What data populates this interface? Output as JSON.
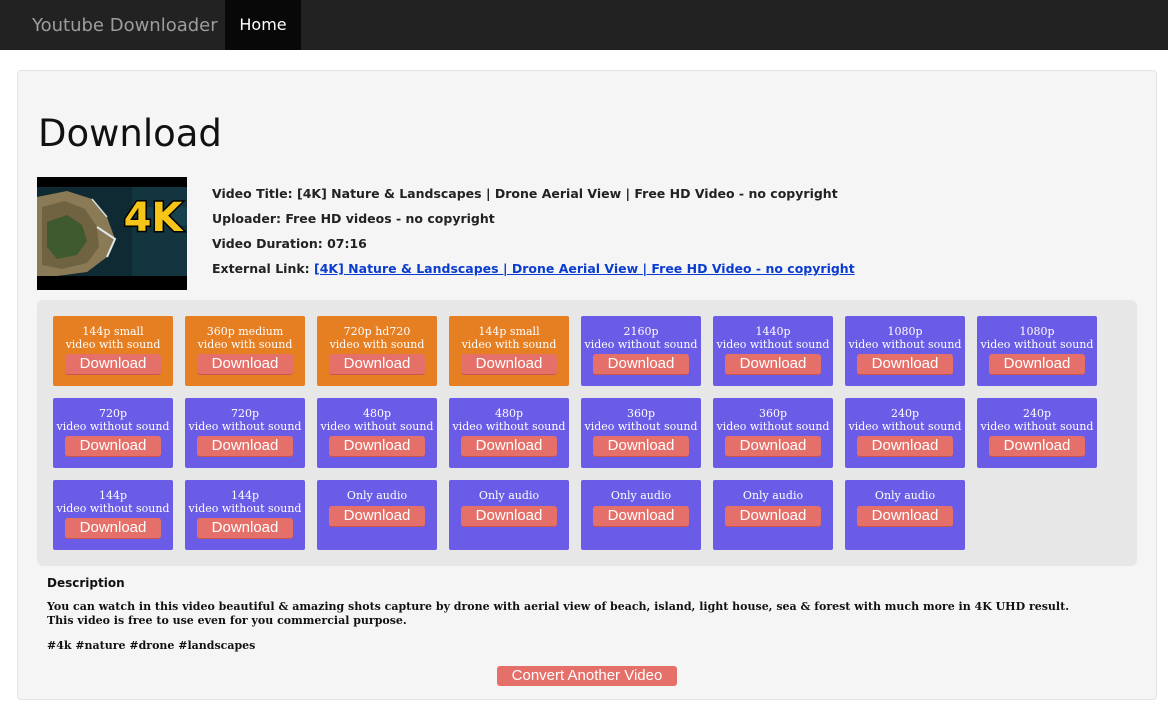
{
  "navbar": {
    "brand": "Youtube Downloader",
    "home": "Home"
  },
  "page": {
    "title": "Download"
  },
  "video": {
    "thumb_text": "4K",
    "title_label": "Video Title: ",
    "title": "[4K] Nature & Landscapes | Drone Aerial View | Free HD Video - no copyright",
    "uploader_label": "Uploader: ",
    "uploader": "Free HD videos - no copyright",
    "duration_label": "Video Duration: ",
    "duration": "07:16",
    "link_label": "External Link: ",
    "link_text": "[4K] Nature & Landscapes | Drone Aerial View | Free HD Video - no copyright"
  },
  "formats": [
    {
      "quality": "144p small",
      "sound": "video with sound",
      "type": "with-sound",
      "button": "Download"
    },
    {
      "quality": "360p medium",
      "sound": "video with sound",
      "type": "with-sound",
      "button": "Download"
    },
    {
      "quality": "720p hd720",
      "sound": "video with sound",
      "type": "with-sound",
      "button": "Download"
    },
    {
      "quality": "144p small",
      "sound": "video with sound",
      "type": "with-sound",
      "button": "Download"
    },
    {
      "quality": "2160p",
      "sound": "video without sound",
      "type": "no-sound",
      "button": "Download"
    },
    {
      "quality": "1440p",
      "sound": "video without sound",
      "type": "no-sound",
      "button": "Download"
    },
    {
      "quality": "1080p",
      "sound": "video without sound",
      "type": "no-sound",
      "button": "Download"
    },
    {
      "quality": "1080p",
      "sound": "video without sound",
      "type": "no-sound",
      "button": "Download"
    },
    {
      "quality": "720p",
      "sound": "video without sound",
      "type": "no-sound",
      "button": "Download"
    },
    {
      "quality": "720p",
      "sound": "video without sound",
      "type": "no-sound",
      "button": "Download"
    },
    {
      "quality": "480p",
      "sound": "video without sound",
      "type": "no-sound",
      "button": "Download"
    },
    {
      "quality": "480p",
      "sound": "video without sound",
      "type": "no-sound",
      "button": "Download"
    },
    {
      "quality": "360p",
      "sound": "video without sound",
      "type": "no-sound",
      "button": "Download"
    },
    {
      "quality": "360p",
      "sound": "video without sound",
      "type": "no-sound",
      "button": "Download"
    },
    {
      "quality": "240p",
      "sound": "video without sound",
      "type": "no-sound",
      "button": "Download"
    },
    {
      "quality": "240p",
      "sound": "video without sound",
      "type": "no-sound",
      "button": "Download"
    },
    {
      "quality": "144p",
      "sound": "video without sound",
      "type": "no-sound",
      "button": "Download"
    },
    {
      "quality": "144p",
      "sound": "video without sound",
      "type": "no-sound",
      "button": "Download"
    },
    {
      "quality": "Only audio",
      "sound": "",
      "type": "audio",
      "button": "Download"
    },
    {
      "quality": "Only audio",
      "sound": "",
      "type": "audio",
      "button": "Download"
    },
    {
      "quality": "Only audio",
      "sound": "",
      "type": "audio",
      "button": "Download"
    },
    {
      "quality": "Only audio",
      "sound": "",
      "type": "audio",
      "button": "Download"
    },
    {
      "quality": "Only audio",
      "sound": "",
      "type": "audio",
      "button": "Download"
    }
  ],
  "description": {
    "heading": "Description",
    "body": "You can watch in this video beautiful & amazing shots capture by drone with aerial view of beach, island, light house, sea & forest with much more in 4K UHD result. This video is free to use even for you commercial purpose.",
    "tags": "#4k #nature #drone #landscapes"
  },
  "convert_button": "Convert Another Video",
  "colors": {
    "navbar": "#222222",
    "with_sound": "#e67e22",
    "no_sound": "#6b5ce7",
    "button": "#e5706a",
    "link": "#0a3ccf"
  }
}
